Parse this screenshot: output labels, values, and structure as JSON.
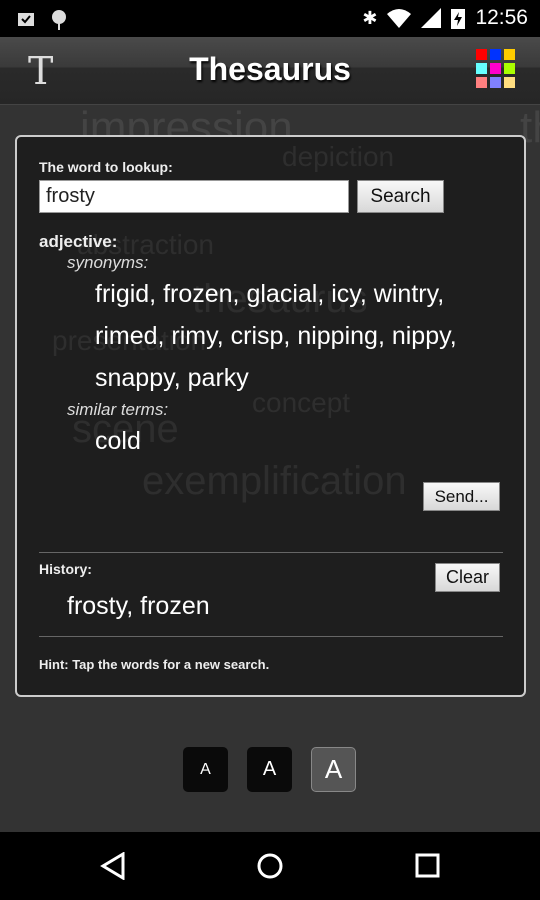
{
  "status_bar": {
    "time": "12:56",
    "icons": [
      "briefcase-check-icon",
      "android-debug-icon",
      "bluetooth-icon",
      "wifi-icon",
      "cell-signal-icon",
      "battery-charging-icon"
    ]
  },
  "app_bar": {
    "title": "Thesaurus",
    "logo_letter": "T",
    "palette_colors": [
      "#ff0000",
      "#0033ff",
      "#ffcc00",
      "#66ffff",
      "#ff00cc",
      "#aaff00",
      "#ff8080",
      "#8080ff",
      "#ffdd80"
    ]
  },
  "background_words": [
    "impression",
    "depiction",
    "abstraction",
    "thesaurus",
    "presentation",
    "concept",
    "scene",
    "exemplification"
  ],
  "lookup": {
    "label": "The word to lookup:",
    "value": "frosty",
    "search_label": "Search"
  },
  "results": {
    "pos": "adjective:",
    "synonyms_label": "synonyms:",
    "synonyms": "frigid, frozen, glacial, icy, wintry, rimed, rimy, crisp, nipping, nippy, snappy, parky",
    "similar_label": "similar terms:",
    "similar": "cold",
    "send_label": "Send..."
  },
  "history": {
    "label": "History:",
    "clear_label": "Clear",
    "words": "frosty, frozen"
  },
  "hint": "Hint: Tap the words for a new search.",
  "font_sizes": [
    {
      "label": "A",
      "selected": false
    },
    {
      "label": "A",
      "selected": false
    },
    {
      "label": "A",
      "selected": true
    }
  ]
}
